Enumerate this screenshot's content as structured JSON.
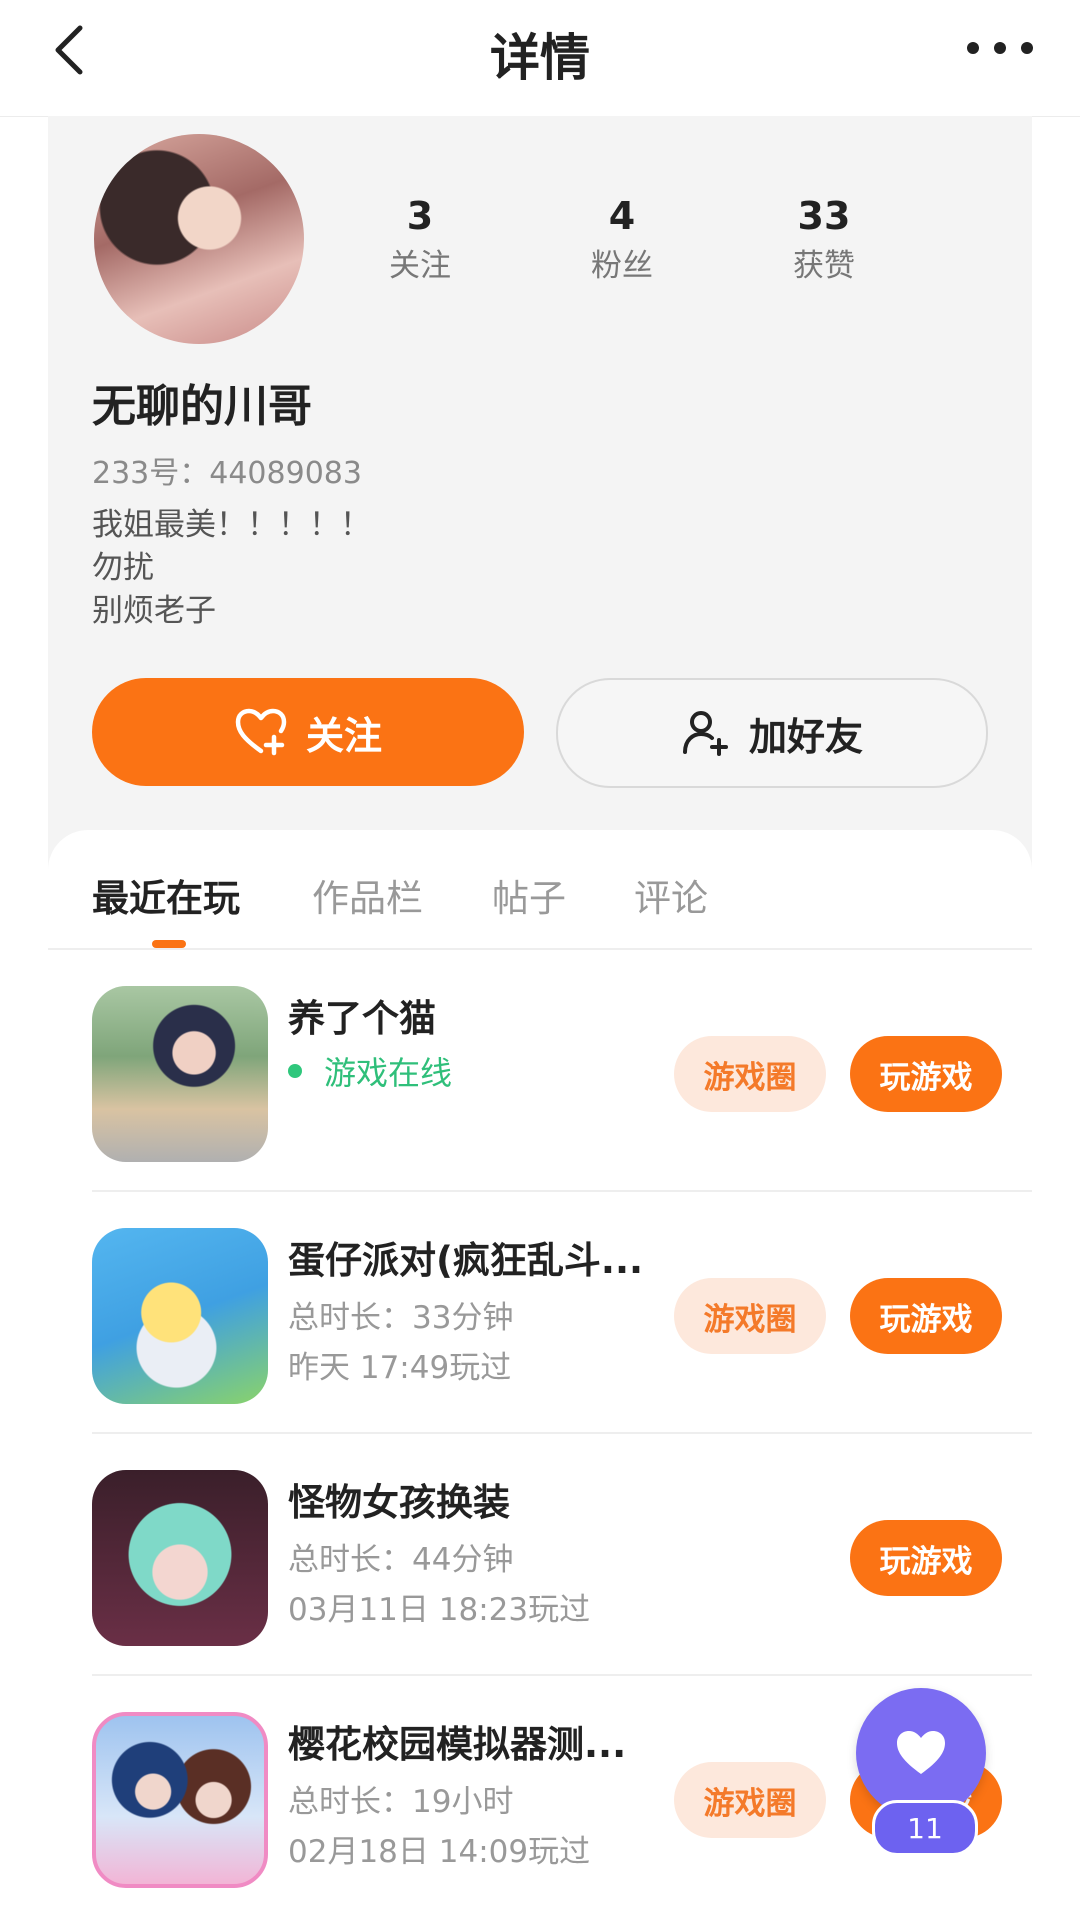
{
  "header": {
    "title": "详情",
    "back_icon": "chevron-left-icon",
    "more_icon": "more-dots-icon"
  },
  "profile": {
    "stats": [
      {
        "value": "3",
        "label": "关注"
      },
      {
        "value": "4",
        "label": "粉丝"
      },
      {
        "value": "33",
        "label": "获赞"
      }
    ],
    "name": "无聊的川哥",
    "id_text": "233号：44089083",
    "bio": [
      "我姐最美！！！！！",
      "勿扰",
      "别烦老子"
    ],
    "follow_label": "关注",
    "add_friend_label": "加好友"
  },
  "tabs": [
    "最近在玩",
    "作品栏",
    "帖子",
    "评论"
  ],
  "active_tab": 0,
  "games": [
    {
      "name": "养了个猫",
      "status": "游戏在线",
      "circle_label": "游戏圈",
      "play_label": "玩游戏"
    },
    {
      "name": "蛋仔派对(疯狂乱斗...",
      "duration": "总时长：33分钟",
      "last_played": "昨天 17:49玩过",
      "circle_label": "游戏圈",
      "play_label": "玩游戏"
    },
    {
      "name": "怪物女孩换装",
      "duration": "总时长：44分钟",
      "last_played": "03月11日 18:23玩过",
      "play_label": "玩游戏"
    },
    {
      "name": "樱花校园模拟器测...",
      "duration": "总时长：19小时",
      "last_played": "02月18日 14:09玩过",
      "circle_label": "游戏圈",
      "play_label": "玩游戏"
    }
  ],
  "floating_like": {
    "count": "11",
    "icon": "heart-icon"
  },
  "colors": {
    "accent": "#fb7314",
    "online": "#2fbf7a",
    "like_bubble": "#7b6cf2"
  }
}
